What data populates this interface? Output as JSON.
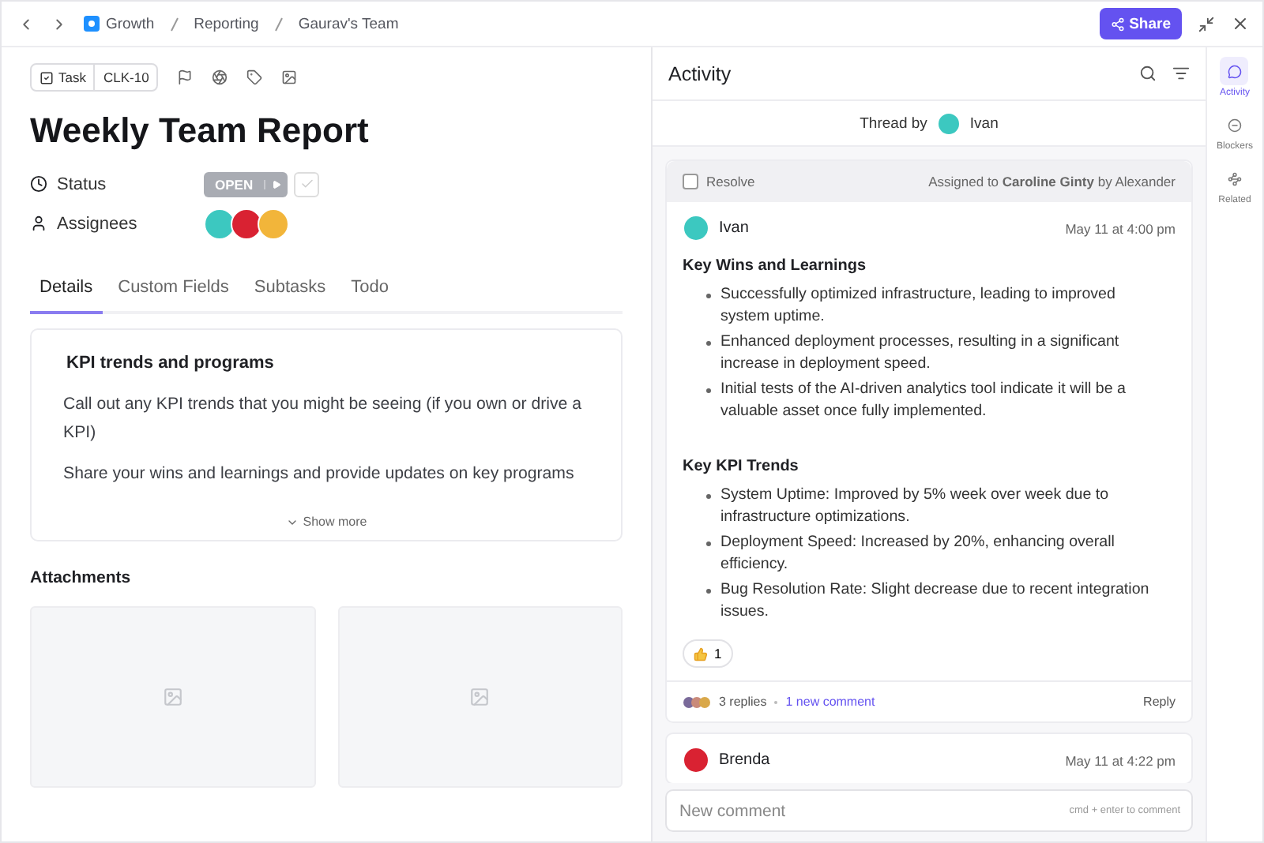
{
  "breadcrumbs": [
    "Growth",
    "Reporting",
    "Gaurav's Team"
  ],
  "share_button": "Share",
  "task": {
    "type": "Task",
    "id": "CLK-10",
    "title": "Weekly Team Report",
    "status": {
      "label": "Status",
      "value": "OPEN",
      "complete": false
    },
    "assignees": {
      "label": "Assignees",
      "avatars": [
        {
          "color": "#3cc8c0"
        },
        {
          "color": "#d92232"
        },
        {
          "color": "#f2b53a"
        }
      ]
    }
  },
  "tabs": [
    {
      "label": "Details",
      "selected": true
    },
    {
      "label": "Custom Fields",
      "selected": false
    },
    {
      "label": "Subtasks",
      "selected": false
    },
    {
      "label": "Todo",
      "selected": false
    }
  ],
  "description": {
    "heading": "KPI trends and programs",
    "paragraphs": [
      "Call out any KPI trends that you might be seeing (if you own or drive a KPI)",
      "Share your wins and learnings and provide updates on key programs"
    ],
    "show_more": "Show more"
  },
  "attachments": {
    "title": "Attachments",
    "items": [
      {
        "kind": "image"
      },
      {
        "kind": "image"
      }
    ]
  },
  "activity": {
    "title": "Activity",
    "thread_by": {
      "label": "Thread by",
      "name": "Ivan",
      "color": "#3cc8c0"
    },
    "thread": {
      "resolve": {
        "label": "Resolve",
        "checked": false
      },
      "assigned": "Assigned to **Caroline Ginty** by Alexander",
      "comment": {
        "author": "Ivan",
        "color": "#3cc8c0",
        "time": "May 11 at 4:00 pm",
        "sections": [
          {
            "heading": "Key Wins and Learnings",
            "bullets": [
              "Successfully optimized infrastructure, leading to improved system uptime.",
              "Enhanced deployment processes, resulting in a significant increase in deployment speed.",
              "Initial tests of the AI-driven analytics tool indicate it will be a valuable asset once fully implemented."
            ]
          },
          {
            "heading": "Key KPI Trends",
            "bullets": [
              "System Uptime: Improved by 5% week over week due to infrastructure optimizations.",
              "Deployment Speed: Increased by 20%, enhancing overall efficiency.",
              "Bug Resolution Rate: Slight decrease due to recent integration issues."
            ]
          }
        ],
        "reaction_count": "1",
        "replies": "3 replies",
        "new_comment": "1 new comment",
        "reply": "Reply"
      }
    },
    "next_comment": {
      "author": "Brenda",
      "color": "#d92232",
      "time": "May 11 at 4:22 pm"
    },
    "composer": {
      "placeholder": "New comment",
      "hint": "cmd + enter to comment"
    }
  },
  "rail": [
    {
      "label": "Activity",
      "kind": "activity",
      "selected": true
    },
    {
      "label": "Blockers",
      "kind": "blockers",
      "selected": false
    },
    {
      "label": "Related",
      "kind": "related",
      "selected": false
    }
  ]
}
